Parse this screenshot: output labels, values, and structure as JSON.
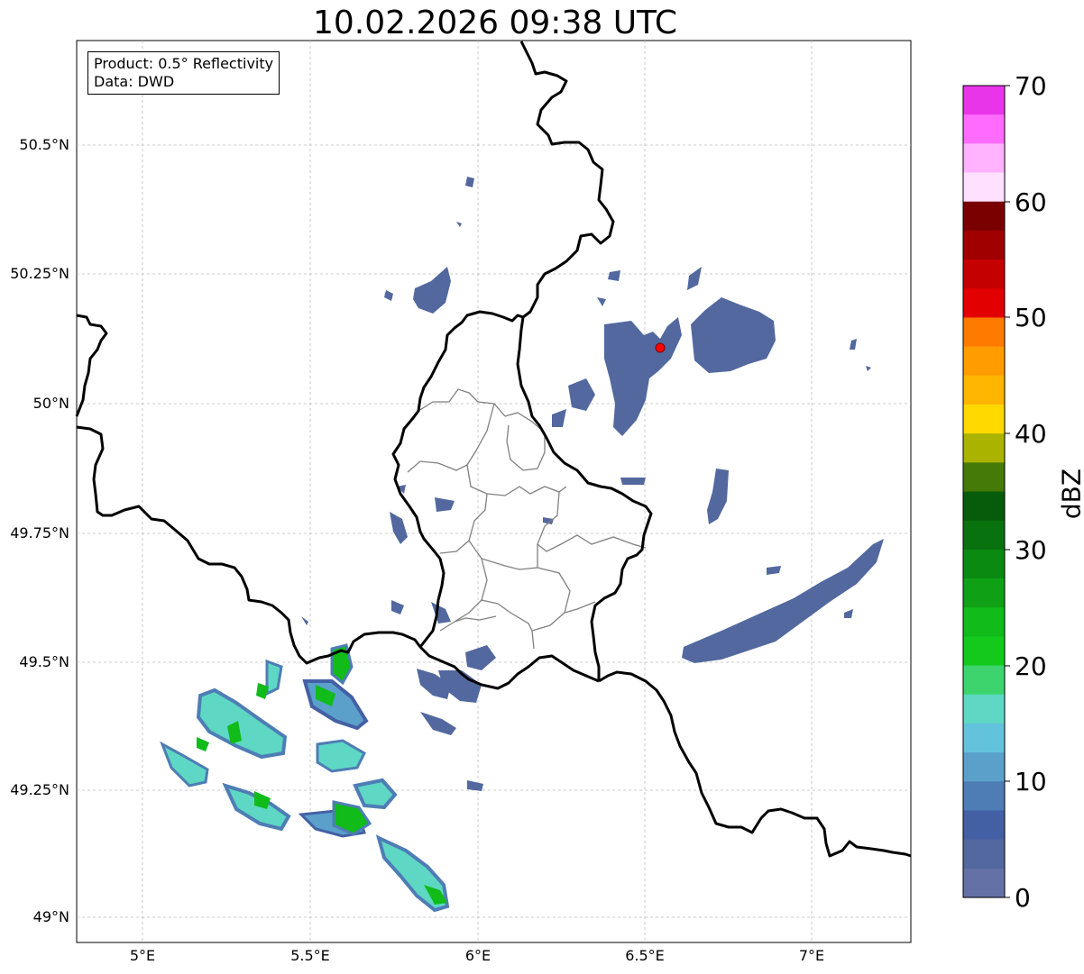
{
  "title": "10.02.2026 09:38 UTC",
  "info_box": {
    "product": "Product: 0.5° Reflectivity",
    "data": "Data: DWD"
  },
  "lat_labels": [
    "50.5°N",
    "50.25°N",
    "50°N",
    "49.75°N",
    "49.5°N",
    "49.25°N",
    "49°N"
  ],
  "lon_labels": [
    "5°E",
    "5.5°E",
    "6°E",
    "6.5°E",
    "7°E"
  ],
  "colorbar": {
    "label": "dBZ",
    "tick_labels": [
      "70",
      "60",
      "50",
      "40",
      "30",
      "20",
      "10",
      "0"
    ],
    "colors": [
      "#e935e9",
      "#ff6bff",
      "#ffb3ff",
      "#ffe0ff",
      "#7a0000",
      "#a00000",
      "#c40000",
      "#e30000",
      "#ff7b00",
      "#ff9d00",
      "#ffb600",
      "#ffd900",
      "#aab300",
      "#457a08",
      "#075c0c",
      "#08720e",
      "#0b8a12",
      "#0fa016",
      "#10bb1a",
      "#12c91c",
      "#3dd46e",
      "#5ed8c4",
      "#64c3dc",
      "#5aa0cb",
      "#4e7db5",
      "#4460a4",
      "#52689e",
      "#6371a6"
    ]
  },
  "site_marker": {
    "color": "#ff0000",
    "label": ""
  },
  "map_colors": {
    "border": "#000000",
    "district": "#808080",
    "grid": "#bdbdbd",
    "precip_low": "#52689e"
  }
}
